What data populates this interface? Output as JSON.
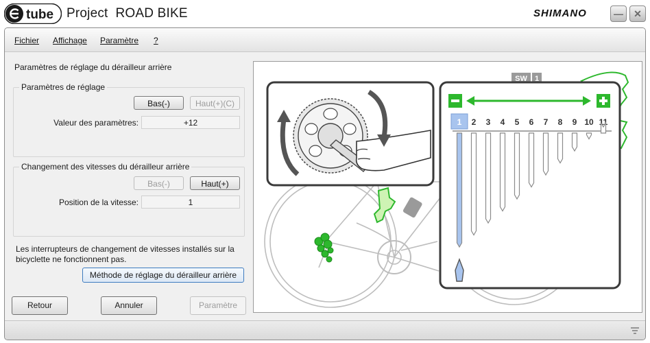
{
  "app": {
    "logo_text": "tube",
    "title": "Project  ROAD BIKE",
    "brand": "SHIMANO",
    "minimize_icon": "minimize-icon",
    "close_icon": "close-icon"
  },
  "menu": {
    "items": [
      {
        "label": "Fichier"
      },
      {
        "label": "Affichage"
      },
      {
        "label": "Paramètre"
      },
      {
        "label": "?"
      }
    ]
  },
  "main": {
    "section_title": "Paramètres de réglage du dérailleur arrière",
    "adjust_group": {
      "title": "Paramètres de réglage",
      "down_button": "Bas(-)",
      "up_button": "Haut(+)(C)",
      "value_label": "Valeur des paramètres:",
      "value": "+12"
    },
    "shift_group": {
      "title": "Changement des vitesses du dérailleur arrière",
      "down_button": "Bas(-)",
      "up_button": "Haut(+)",
      "position_label": "Position de la vitesse:",
      "position": "1"
    },
    "note": "Les interrupteurs de changement de vitesses installés sur la bicyclette ne fonctionnent pas.",
    "method_button": "Méthode de réglage du dérailleur arrière",
    "footer": {
      "back_button": "Retour",
      "cancel_button": "Annuler",
      "param_button": "Paramètre"
    }
  },
  "illustration": {
    "sw_label": "SW",
    "sw_number": "1",
    "minus_icon": "minus-icon",
    "plus_icon": "plus-icon",
    "gears": [
      "1",
      "2",
      "3",
      "4",
      "5",
      "6",
      "7",
      "8",
      "9",
      "10",
      "11"
    ],
    "selected_gear": "1",
    "accent_green": "#2db82d",
    "selected_blue": "#a8c4ee"
  }
}
